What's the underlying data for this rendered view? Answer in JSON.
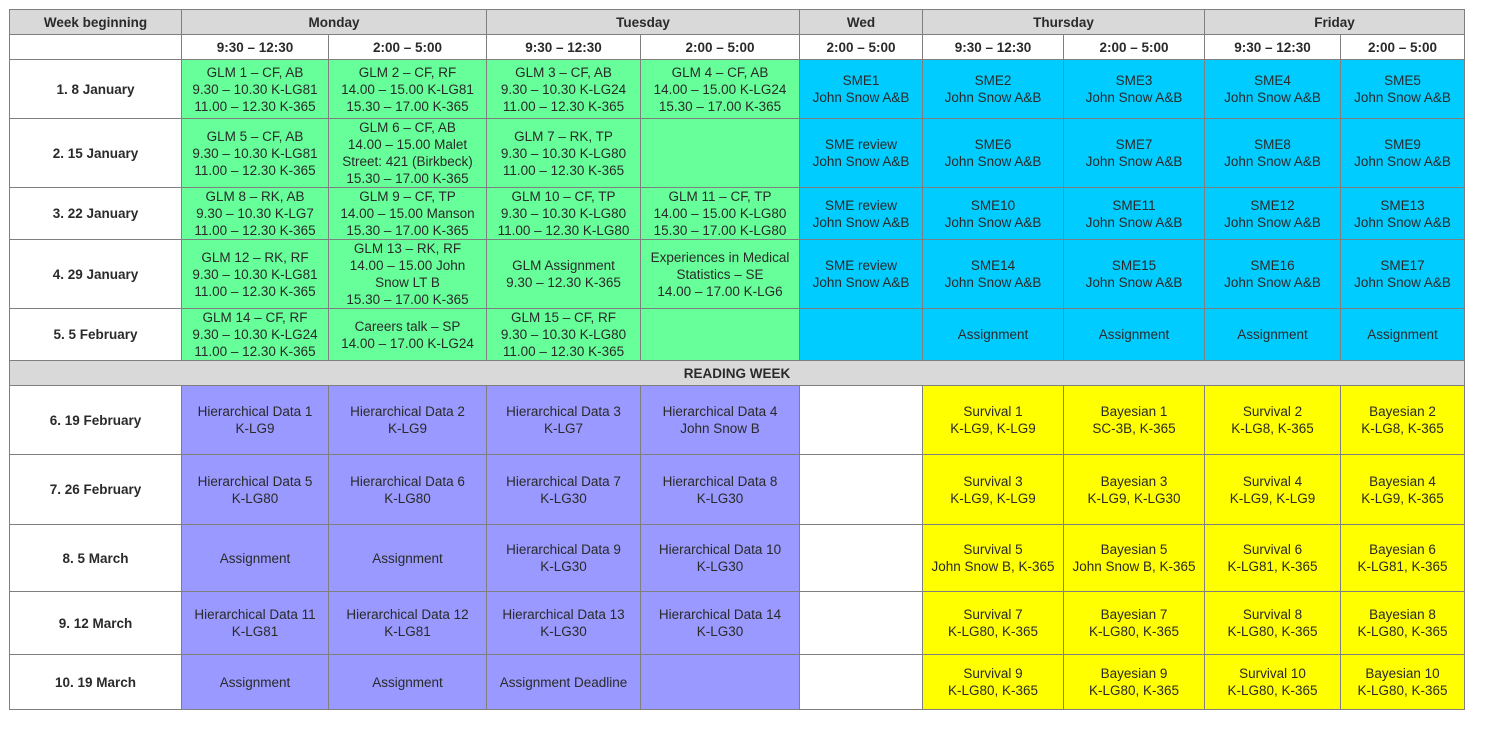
{
  "header": {
    "week_label": "Week beginning",
    "days": [
      "Monday",
      "Tuesday",
      "Wed",
      "Thursday",
      "Friday"
    ],
    "times": [
      "9:30 – 12:30",
      "2:00 – 5:00",
      "9:30 – 12:30",
      "2:00 – 5:00",
      "2:00 – 5:00",
      "9:30 – 12:30",
      "2:00 – 5:00",
      "9:30 – 12:30",
      "2:00 – 5:00"
    ]
  },
  "reading_week": "READING WEEK",
  "colors": {
    "green": "#66ff99",
    "blue": "#00ccff",
    "purple": "#9999ff",
    "yellow": "#ffff00",
    "header_gray": "#d9d9d9"
  },
  "rows": [
    {
      "week": "1. 8 January",
      "cells": [
        {
          "c": "g",
          "lines": [
            "GLM 1 – CF, AB",
            "9.30 – 10.30  K-LG81",
            "11.00 – 12.30  K-365"
          ]
        },
        {
          "c": "g",
          "lines": [
            "GLM 2 – CF, RF",
            "14.00 – 15.00  K-LG81",
            "15.30 – 17.00  K-365"
          ]
        },
        {
          "c": "g",
          "lines": [
            "GLM 3 – CF, AB",
            "9.30 – 10.30  K-LG24",
            "11.00 – 12.30  K-365"
          ]
        },
        {
          "c": "g",
          "lines": [
            "GLM 4 – CF, AB",
            "14.00 – 15.00  K-LG24",
            "15.30 – 17.00  K-365"
          ]
        },
        {
          "c": "b",
          "lines": [
            "SME1",
            "John Snow A&B"
          ]
        },
        {
          "c": "b",
          "lines": [
            "SME2",
            "John Snow A&B"
          ]
        },
        {
          "c": "b",
          "lines": [
            "SME3",
            "John Snow A&B"
          ]
        },
        {
          "c": "b",
          "lines": [
            "SME4",
            "John Snow A&B"
          ]
        },
        {
          "c": "b",
          "lines": [
            "SME5",
            "John Snow A&B"
          ]
        }
      ]
    },
    {
      "week": "2. 15 January",
      "cells": [
        {
          "c": "g",
          "lines": [
            "GLM 5 – CF, AB",
            "9.30 – 10.30  K-LG81",
            "11.00 – 12.30  K-365"
          ]
        },
        {
          "c": "g",
          "lines": [
            "GLM 6 – CF, AB",
            "14.00 – 15.00  Malet",
            "Street: 421 (Birkbeck)",
            "15.30 – 17.00  K-365"
          ]
        },
        {
          "c": "g",
          "lines": [
            "GLM 7 – RK, TP",
            "9.30 – 10.30  K-LG80",
            "11.00 – 12.30  K-365"
          ]
        },
        {
          "c": "g",
          "lines": []
        },
        {
          "c": "b",
          "lines": [
            "SME review",
            "John Snow A&B"
          ]
        },
        {
          "c": "b",
          "lines": [
            "SME6",
            "John Snow A&B"
          ]
        },
        {
          "c": "b",
          "lines": [
            "SME7",
            "John Snow A&B"
          ]
        },
        {
          "c": "b",
          "lines": [
            "SME8",
            "John Snow A&B"
          ]
        },
        {
          "c": "b",
          "lines": [
            "SME9",
            "John Snow A&B"
          ]
        }
      ]
    },
    {
      "week": "3. 22 January",
      "cells": [
        {
          "c": "g",
          "lines": [
            "GLM 8 – RK, AB",
            "9.30 – 10.30  K-LG7",
            "11.00 – 12.30  K-365"
          ]
        },
        {
          "c": "g",
          "lines": [
            "GLM 9 – CF, TP",
            "14.00 – 15.00  Manson",
            "15.30 – 17.00  K-365"
          ]
        },
        {
          "c": "g",
          "lines": [
            "GLM 10 – CF, TP",
            "9.30 – 10.30  K-LG80",
            "11.00 – 12.30  K-LG80"
          ]
        },
        {
          "c": "g",
          "lines": [
            "GLM 11 – CF, TP",
            "14.00 – 15.00  K-LG80",
            "15.30 – 17.00  K-LG80"
          ]
        },
        {
          "c": "b",
          "lines": [
            "SME review",
            "John Snow A&B"
          ]
        },
        {
          "c": "b",
          "lines": [
            "SME10",
            "John Snow A&B"
          ]
        },
        {
          "c": "b",
          "lines": [
            "SME11",
            "John Snow A&B"
          ]
        },
        {
          "c": "b",
          "lines": [
            "SME12",
            "John Snow A&B"
          ]
        },
        {
          "c": "b",
          "lines": [
            "SME13",
            "John Snow A&B"
          ]
        }
      ]
    },
    {
      "week": "4. 29 January",
      "cells": [
        {
          "c": "g",
          "lines": [
            "GLM 12 – RK, RF",
            "9.30 – 10.30  K-LG81",
            "11.00 – 12.30  K-365"
          ]
        },
        {
          "c": "g",
          "lines": [
            "GLM 13 – RK, RF",
            "14.00 – 15.00  John",
            "Snow LT B",
            "15.30 – 17.00  K-365"
          ]
        },
        {
          "c": "g",
          "lines": [
            "GLM Assignment",
            "9.30 – 12.30  K-365"
          ]
        },
        {
          "c": "g",
          "lines": [
            "Experiences in Medical",
            "Statistics – SE",
            "14.00 – 17.00  K-LG6"
          ]
        },
        {
          "c": "b",
          "lines": [
            "SME review",
            "John Snow A&B"
          ]
        },
        {
          "c": "b",
          "lines": [
            "SME14",
            "John Snow A&B"
          ]
        },
        {
          "c": "b",
          "lines": [
            "SME15",
            "John Snow A&B"
          ]
        },
        {
          "c": "b",
          "lines": [
            "SME16",
            "John Snow A&B"
          ]
        },
        {
          "c": "b",
          "lines": [
            "SME17",
            "John Snow A&B"
          ]
        }
      ]
    },
    {
      "week": "5. 5 February",
      "cells": [
        {
          "c": "g",
          "lines": [
            "GLM 14 – CF, RF",
            "9.30 – 10.30  K-LG24",
            "11.00 – 12.30  K-365"
          ]
        },
        {
          "c": "g",
          "lines": [
            "Careers talk – SP",
            "14.00 – 17.00  K-LG24"
          ]
        },
        {
          "c": "g",
          "lines": [
            "GLM 15 – CF, RF",
            "9.30 – 10.30  K-LG80",
            "11.00 – 12.30  K-365"
          ]
        },
        {
          "c": "g",
          "lines": []
        },
        {
          "c": "b",
          "lines": []
        },
        {
          "c": "b",
          "lines": [
            "Assignment"
          ]
        },
        {
          "c": "b",
          "lines": [
            "Assignment"
          ]
        },
        {
          "c": "b",
          "lines": [
            "Assignment"
          ]
        },
        {
          "c": "b",
          "lines": [
            "Assignment"
          ]
        }
      ]
    },
    {
      "week": "6. 19 February",
      "cells": [
        {
          "c": "p",
          "lines": [
            "Hierarchical Data 1",
            "K-LG9"
          ]
        },
        {
          "c": "p",
          "lines": [
            "Hierarchical Data 2",
            "K-LG9"
          ]
        },
        {
          "c": "p",
          "lines": [
            "Hierarchical Data 3",
            "K-LG7"
          ]
        },
        {
          "c": "p",
          "lines": [
            "Hierarchical Data 4",
            "John Snow B"
          ]
        },
        {
          "c": "w",
          "lines": []
        },
        {
          "c": "y",
          "lines": [
            "Survival 1",
            "K-LG9, K-LG9"
          ]
        },
        {
          "c": "y",
          "lines": [
            "Bayesian 1",
            "SC-3B, K-365"
          ]
        },
        {
          "c": "y",
          "lines": [
            "Survival 2",
            "K-LG8, K-365"
          ]
        },
        {
          "c": "y",
          "lines": [
            "Bayesian 2",
            "K-LG8, K-365"
          ]
        }
      ]
    },
    {
      "week": "7. 26 February",
      "cells": [
        {
          "c": "p",
          "lines": [
            "Hierarchical Data 5",
            "K-LG80"
          ]
        },
        {
          "c": "p",
          "lines": [
            "Hierarchical Data 6",
            "K-LG80"
          ]
        },
        {
          "c": "p",
          "lines": [
            "Hierarchical Data 7",
            "K-LG30"
          ]
        },
        {
          "c": "p",
          "lines": [
            "Hierarchical Data 8",
            "K-LG30"
          ]
        },
        {
          "c": "w",
          "lines": []
        },
        {
          "c": "y",
          "lines": [
            "Survival 3",
            "K-LG9, K-LG9"
          ]
        },
        {
          "c": "y",
          "lines": [
            "Bayesian 3",
            "K-LG9, K-LG30"
          ]
        },
        {
          "c": "y",
          "lines": [
            "Survival 4",
            "K-LG9, K-LG9"
          ]
        },
        {
          "c": "y",
          "lines": [
            "Bayesian 4",
            "K-LG9, K-365"
          ]
        }
      ]
    },
    {
      "week": "8. 5 March",
      "cells": [
        {
          "c": "p",
          "lines": [
            "Assignment"
          ]
        },
        {
          "c": "p",
          "lines": [
            "Assignment"
          ]
        },
        {
          "c": "p",
          "lines": [
            "Hierarchical Data 9",
            "K-LG30"
          ]
        },
        {
          "c": "p",
          "lines": [
            "Hierarchical Data 10",
            "K-LG30"
          ]
        },
        {
          "c": "w",
          "lines": []
        },
        {
          "c": "y",
          "lines": [
            "Survival 5",
            "John Snow B, K-365"
          ]
        },
        {
          "c": "y",
          "lines": [
            "Bayesian 5",
            "John Snow B, K-365"
          ]
        },
        {
          "c": "y",
          "lines": [
            "Survival 6",
            "K-LG81, K-365"
          ]
        },
        {
          "c": "y",
          "lines": [
            "Bayesian 6",
            "K-LG81, K-365"
          ]
        }
      ]
    },
    {
      "week": "9. 12 March",
      "cells": [
        {
          "c": "p",
          "lines": [
            "Hierarchical Data 11",
            "K-LG81"
          ]
        },
        {
          "c": "p",
          "lines": [
            "Hierarchical Data 12",
            "K-LG81"
          ]
        },
        {
          "c": "p",
          "lines": [
            "Hierarchical Data 13",
            "K-LG30"
          ]
        },
        {
          "c": "p",
          "lines": [
            "Hierarchical Data 14",
            "K-LG30"
          ]
        },
        {
          "c": "w",
          "lines": []
        },
        {
          "c": "y",
          "lines": [
            "Survival 7",
            "K-LG80, K-365"
          ]
        },
        {
          "c": "y",
          "lines": [
            "Bayesian 7",
            "K-LG80, K-365"
          ]
        },
        {
          "c": "y",
          "lines": [
            "Survival 8",
            "K-LG80, K-365"
          ]
        },
        {
          "c": "y",
          "lines": [
            "Bayesian 8",
            "K-LG80, K-365"
          ]
        }
      ]
    },
    {
      "week": "10. 19 March",
      "cells": [
        {
          "c": "p",
          "lines": [
            "Assignment"
          ]
        },
        {
          "c": "p",
          "lines": [
            "Assignment"
          ]
        },
        {
          "c": "p",
          "lines": [
            "Assignment Deadline"
          ]
        },
        {
          "c": "p",
          "lines": []
        },
        {
          "c": "w",
          "lines": []
        },
        {
          "c": "y",
          "lines": [
            "Survival 9",
            "K-LG80, K-365"
          ]
        },
        {
          "c": "y",
          "lines": [
            "Bayesian 9",
            "K-LG80, K-365"
          ]
        },
        {
          "c": "y",
          "lines": [
            "Survival 10",
            "K-LG80, K-365"
          ]
        },
        {
          "c": "y",
          "lines": [
            "Bayesian 10",
            "K-LG80, K-365"
          ]
        }
      ]
    }
  ]
}
